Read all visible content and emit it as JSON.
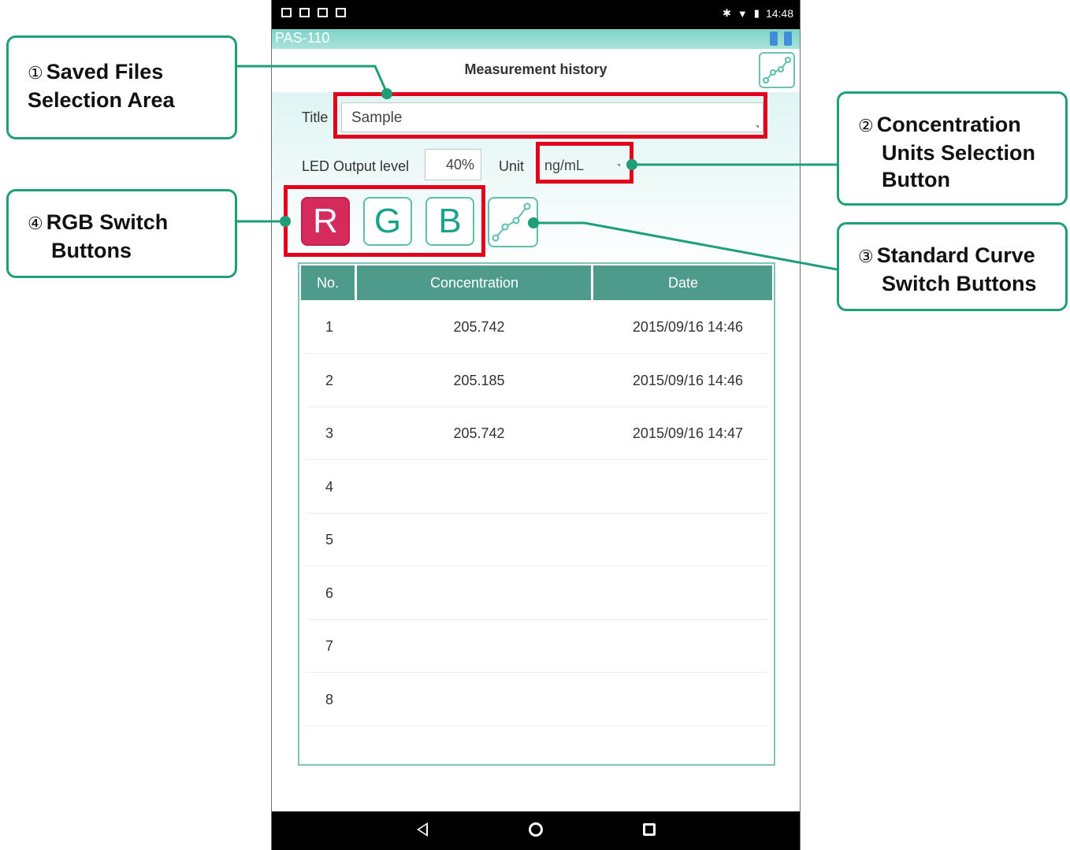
{
  "status_bar": {
    "time": "14:48"
  },
  "app_bar": {
    "device_name": "PAS-110"
  },
  "header": {
    "title": "Measurement history"
  },
  "form": {
    "title_label": "Title",
    "title_value": "Sample",
    "led_label": "LED Output level",
    "led_value": "40%",
    "unit_label": "Unit",
    "unit_value": "ng/mL"
  },
  "rgb": {
    "r": "R",
    "g": "G",
    "b": "B",
    "selected": "R"
  },
  "table": {
    "headers": [
      "No.",
      "Concentration",
      "Date"
    ],
    "rows": [
      {
        "no": "1",
        "conc": "205.742",
        "date": "2015/09/16 14:46"
      },
      {
        "no": "2",
        "conc": "205.185",
        "date": "2015/09/16 14:46"
      },
      {
        "no": "3",
        "conc": "205.742",
        "date": "2015/09/16 14:47"
      },
      {
        "no": "4",
        "conc": "",
        "date": ""
      },
      {
        "no": "5",
        "conc": "",
        "date": ""
      },
      {
        "no": "6",
        "conc": "",
        "date": ""
      },
      {
        "no": "7",
        "conc": "",
        "date": ""
      },
      {
        "no": "8",
        "conc": "",
        "date": ""
      }
    ]
  },
  "callouts": {
    "c1": {
      "num": "①",
      "line1": "Saved Files",
      "line2": "Selection Area"
    },
    "c2": {
      "num": "②",
      "line1": "Concentration",
      "line2": "Units Selection",
      "line3": "Button"
    },
    "c3": {
      "num": "③",
      "line1": "Standard Curve",
      "line2": "Switch Buttons"
    },
    "c4": {
      "num": "④",
      "line1": "RGB Switch",
      "line2": "Buttons"
    }
  },
  "colors": {
    "accent": "#1f9e7a",
    "highlight": "#e2001a",
    "selected_rgb": "#d62a5c",
    "table_header": "#4e9b8c"
  },
  "icons": [
    "wifi-icon",
    "bluetooth-icon",
    "battery-icon",
    "graph-icon",
    "standard-curve-icon",
    "back-icon",
    "home-icon",
    "recent-apps-icon"
  ]
}
